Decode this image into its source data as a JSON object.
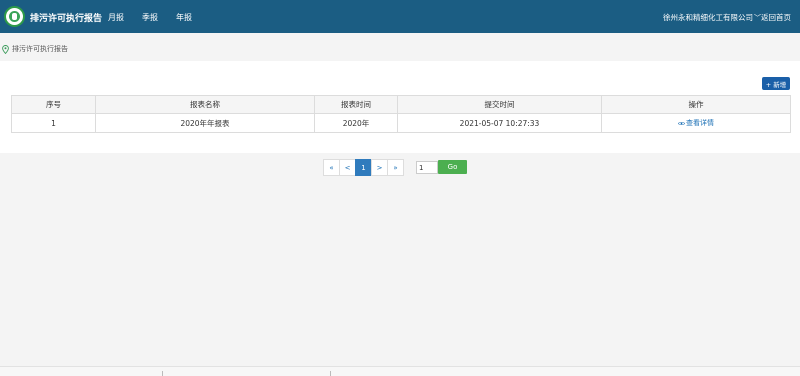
{
  "header": {
    "app_title": "排污许可执行报告",
    "nav": [
      "月报",
      "季报",
      "年报"
    ],
    "company": "徐州永和精细化工有限公司",
    "home_link": "返回首页"
  },
  "breadcrumb": {
    "label": "排污许可执行报告"
  },
  "toolbar": {
    "add_label": "+ 新增"
  },
  "table": {
    "columns": [
      "序号",
      "报表名称",
      "报表时间",
      "提交时间",
      "操作"
    ],
    "rows": [
      {
        "index": "1",
        "name": "2020年年报表",
        "period": "2020年",
        "submitted": "2021-05-07 10:27:33",
        "action": "查看详情"
      }
    ]
  },
  "pagination": {
    "first": "«",
    "prev": "<",
    "current": "1",
    "next": ">",
    "last": "»",
    "goto_value": "1",
    "go_label": "Go"
  },
  "colors": {
    "header_bg": "#1b5d83",
    "primary": "#1a5fa8",
    "go_button": "#4caf50",
    "link": "#1a6fb5"
  }
}
